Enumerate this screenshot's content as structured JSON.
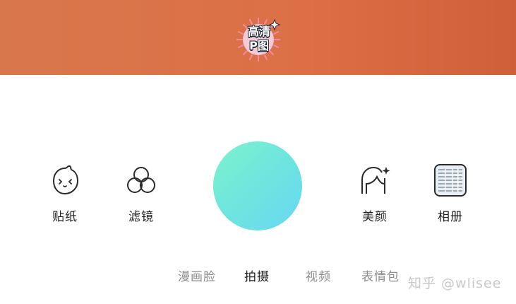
{
  "banner": {
    "badge_line1": "高清",
    "badge_line2": "P图",
    "color": "#dc6f45"
  },
  "tools": {
    "sticker": {
      "label": "贴纸",
      "icon": "blob-face-icon"
    },
    "filter": {
      "label": "滤镜",
      "icon": "three-circles-icon"
    },
    "beauty": {
      "label": "美颜",
      "icon": "face-sparkle-icon"
    },
    "album": {
      "label": "相册",
      "icon": "photo-album-icon"
    }
  },
  "shutter": {
    "gradient_start": "#7ff2cc",
    "gradient_end": "#67d8f2"
  },
  "modes": [
    {
      "label": "漫画脸",
      "active": false
    },
    {
      "label": "拍摄",
      "active": true
    },
    {
      "label": "视频",
      "active": false
    },
    {
      "label": "表情包",
      "active": false
    }
  ],
  "watermark": "知乎 @wlisee"
}
